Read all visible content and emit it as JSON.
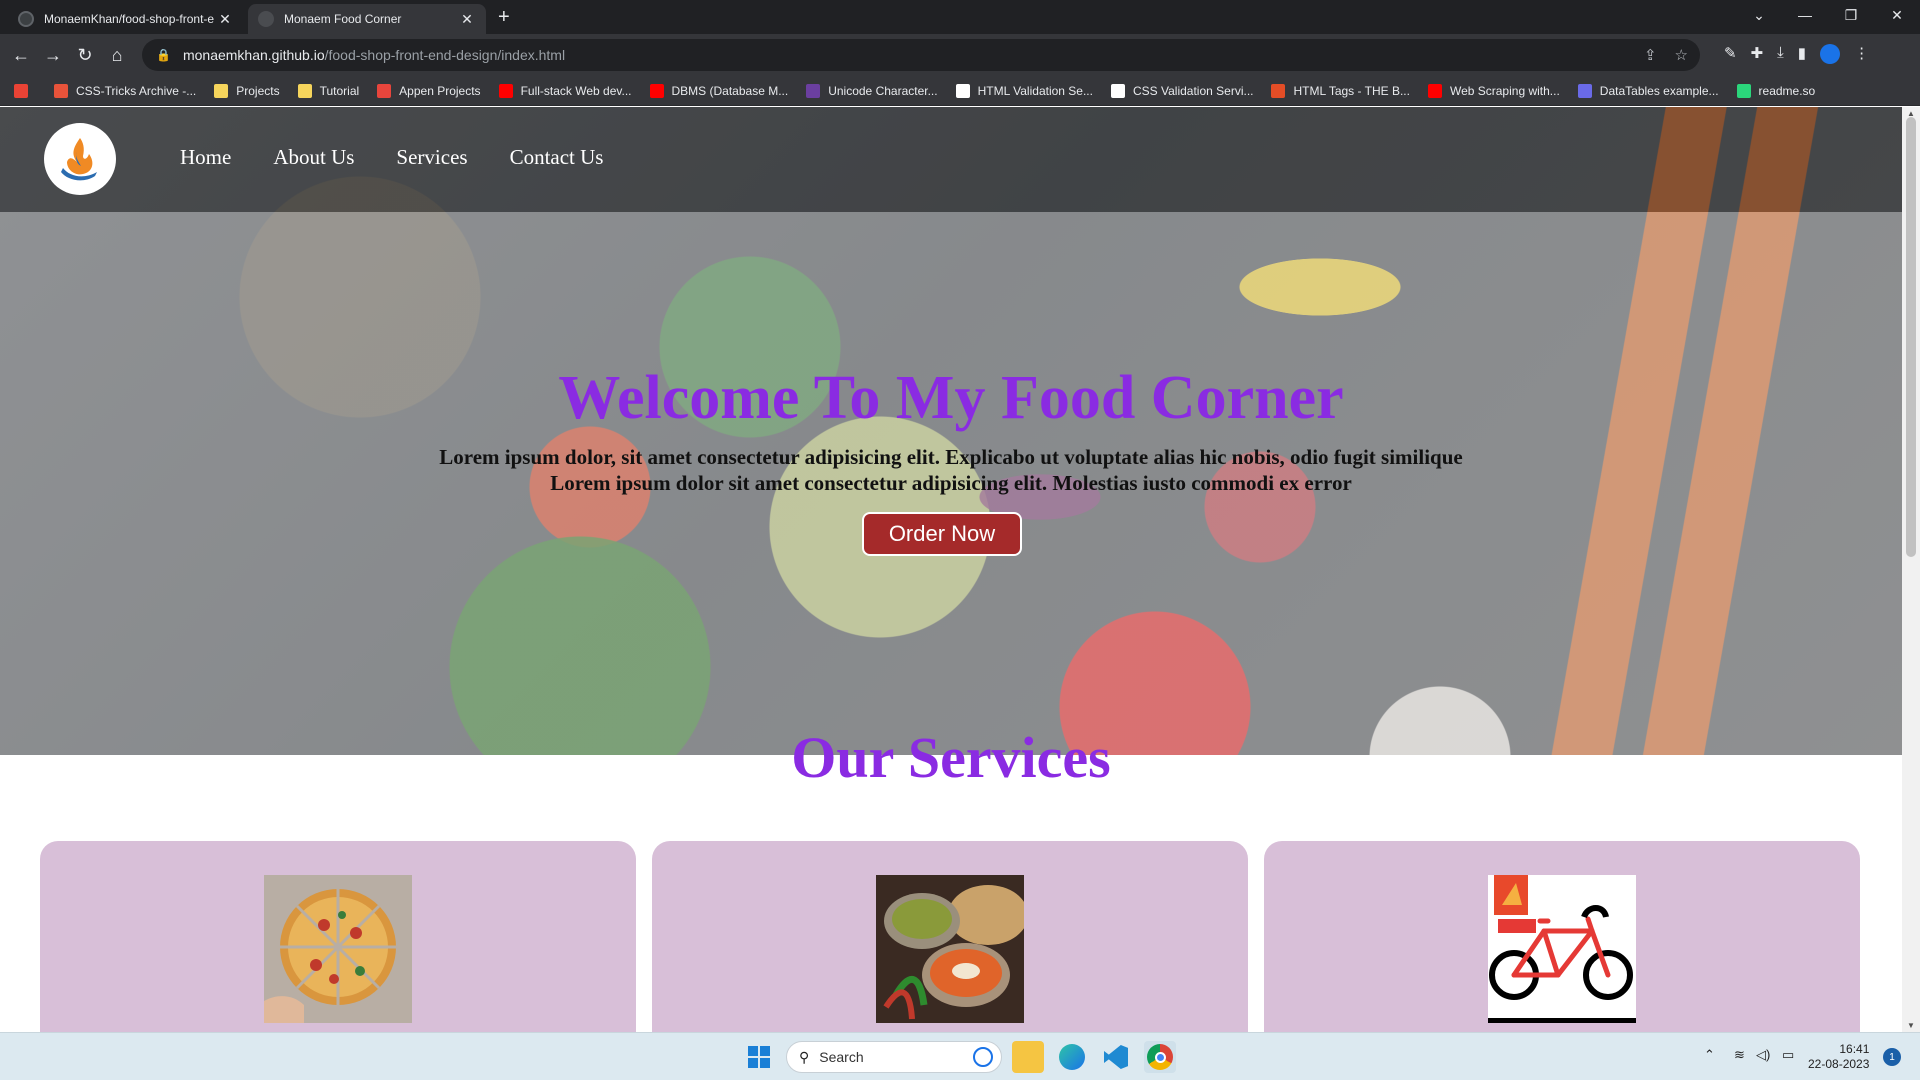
{
  "browser": {
    "tabs": [
      {
        "title": "MonaemKhan/food-shop-front-e",
        "active": false
      },
      {
        "title": "Monaem Food Corner",
        "active": true
      }
    ],
    "new_tab": "+",
    "url_host": "monaemkhan.github.io",
    "url_path": "/food-shop-front-end-design/index.html",
    "bookmarks": [
      {
        "label": "",
        "icon": "gmail-icon",
        "color": "#ea4335"
      },
      {
        "label": "CSS-Tricks Archive -...",
        "icon": "css-tricks-icon",
        "color": "#e8533a"
      },
      {
        "label": "Projects",
        "icon": "folder-icon",
        "color": "#f6d55c"
      },
      {
        "label": "Tutorial",
        "icon": "folder-icon",
        "color": "#f6d55c"
      },
      {
        "label": "Appen Projects",
        "icon": "appen-icon",
        "color": "#e8453c"
      },
      {
        "label": "Full-stack Web dev...",
        "icon": "youtube-icon",
        "color": "#ff0000"
      },
      {
        "label": "DBMS (Database M...",
        "icon": "youtube-icon",
        "color": "#ff0000"
      },
      {
        "label": "Unicode Character...",
        "icon": "unicode-icon",
        "color": "#6b3fa0"
      },
      {
        "label": "HTML Validation Se...",
        "icon": "w3c-icon",
        "color": "#ffffff"
      },
      {
        "label": "CSS Validation Servi...",
        "icon": "w3c-css-icon",
        "color": "#ffffff"
      },
      {
        "label": "HTML Tags - THE B...",
        "icon": "html-tags-icon",
        "color": "#e44d26"
      },
      {
        "label": "Web Scraping with...",
        "icon": "youtube-icon",
        "color": "#ff0000"
      },
      {
        "label": "DataTables example...",
        "icon": "datatables-icon",
        "color": "#6a6ae8"
      },
      {
        "label": "readme.so",
        "icon": "readme-icon",
        "color": "#2bd67b"
      }
    ]
  },
  "site": {
    "nav": [
      "Home",
      "About Us",
      "Services",
      "Contact Us"
    ],
    "hero_title": "Welcome To My Food Corner",
    "hero_line1": "Lorem ipsum dolor, sit amet consectetur adipisicing elit. Explicabo ut voluptate alias hic nobis, odio fugit similique",
    "hero_line2": "Lorem ipsum dolor sit amet consectetur adipisicing elit. Molestias iusto commodi ex error",
    "order_button": "Order Now",
    "services_title": "Our Services",
    "cards": [
      {
        "image": "pizza-image"
      },
      {
        "image": "curry-image"
      },
      {
        "image": "delivery-bicycle-image"
      }
    ],
    "colors": {
      "accent": "#8a2be2",
      "button": "#a52a2a",
      "card": "#d8bfd8"
    }
  },
  "taskbar": {
    "search_placeholder": "Search",
    "time": "16:41",
    "date": "22-08-2023",
    "notifications": "1"
  }
}
